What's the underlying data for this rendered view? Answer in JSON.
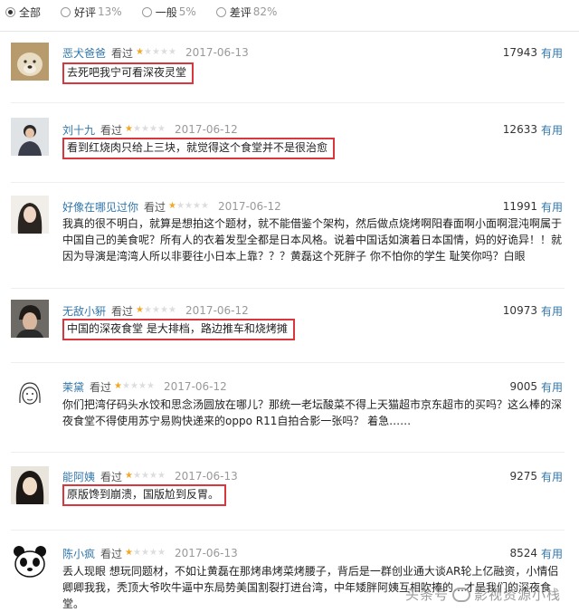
{
  "filters": {
    "all": {
      "label": "全部",
      "pct": ""
    },
    "good": {
      "label": "好评",
      "pct": "13%"
    },
    "mid": {
      "label": "一般",
      "pct": "5%"
    },
    "bad": {
      "label": "差评",
      "pct": "82%"
    }
  },
  "rating_label": "看过",
  "useful_label": "有用",
  "comments": [
    {
      "user": "恶犬爸爸",
      "date": "2017-06-13",
      "votes": "17943",
      "stars": 1,
      "text": "去死吧我宁可看深夜灵堂",
      "avatar": "dog-photo"
    },
    {
      "user": "刘十九",
      "date": "2017-06-12",
      "votes": "12633",
      "stars": 1,
      "text": "看到红烧肉只给上三块，就觉得这个食堂并不是很治愈",
      "avatar": "person-photo"
    },
    {
      "user": "好像在哪见过你",
      "date": "2017-06-12",
      "votes": "11991",
      "stars": 1,
      "text": "我真的很不明白，就算是想拍这个题材，就不能借鉴个架构，然后做点烧烤啊阳春面啊小面啊混沌啊属于中国自己的美食呢？所有人的衣着发型全都是日本风格。说着中国话如演着日本国情，妈的好诡异！！就因为导演是湾湾人所以非要往小日本上靠？？？黄磊这个死胖子 你不怕你的学生 耻笑你吗？白眼",
      "avatar": "girl-photo"
    },
    {
      "user": "无敌小豣",
      "date": "2017-06-12",
      "votes": "10973",
      "stars": 1,
      "text": "中国的深夜食堂 是大排档，路边推车和烧烤摊",
      "avatar": "boy-photo"
    },
    {
      "user": "茉黛",
      "date": "2017-06-12",
      "votes": "9005",
      "stars": 1,
      "text": "你们把湾仔码头水饺和思念汤圆放在哪儿？那统一老坛酸菜不得上天猫超市京东超市的买吗？这么棒的深夜食堂不得使用苏宁易购快递来的oppo R11自拍合影一张吗？ 着急……",
      "avatar": "sketch-face"
    },
    {
      "user": "能阿姨",
      "date": "2017-06-13",
      "votes": "9275",
      "stars": 1,
      "text": "原版馋到崩溃，国版尬到反胃。",
      "avatar": "long-hair-photo"
    },
    {
      "user": "陈小疯",
      "date": "2017-06-13",
      "votes": "8524",
      "stars": 1,
      "text": "丢人现眼 想玩同题材，不如让黄磊在那烤串烤菜烤腰子，背后是一群创业通大谈AR轮上亿融资，小情侣卿卿我我，秃顶大爷吹牛逼中东局势美国割裂打进台湾，中年矮胖阿姨互相吹捧的…才是我们的深夜食堂。",
      "avatar": "panda-icon"
    }
  ],
  "watermark": {
    "prefix": "头条号",
    "suffix": "影视资源小栈"
  }
}
